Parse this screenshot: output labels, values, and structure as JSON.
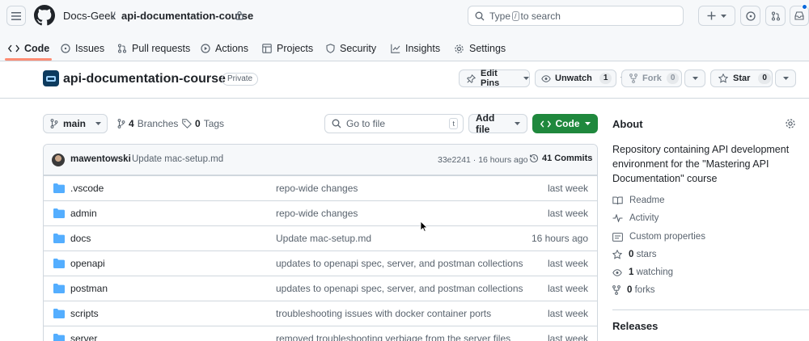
{
  "header": {
    "owner": "Docs-Geek",
    "separator": "/",
    "repo": "api-documentation-course",
    "search_prefix": "Type",
    "search_key": "/",
    "search_suffix": "to search"
  },
  "tabs": [
    {
      "label": "Code",
      "icon": "code-icon",
      "active": true
    },
    {
      "label": "Issues",
      "icon": "issue-icon"
    },
    {
      "label": "Pull requests",
      "icon": "pull-request-icon"
    },
    {
      "label": "Actions",
      "icon": "play-icon"
    },
    {
      "label": "Projects",
      "icon": "table-icon"
    },
    {
      "label": "Security",
      "icon": "shield-icon"
    },
    {
      "label": "Insights",
      "icon": "graph-icon"
    },
    {
      "label": "Settings",
      "icon": "gear-icon"
    }
  ],
  "repo": {
    "name": "api-documentation-course",
    "visibility": "Private",
    "edit_pins": "Edit Pins",
    "unwatch": "Unwatch",
    "watch_count": "1",
    "fork": "Fork",
    "fork_count": "0",
    "star": "Star",
    "star_count": "0"
  },
  "toolbar": {
    "branch": "main",
    "branches_count": "4",
    "branches_label": "Branches",
    "tags_count": "0",
    "tags_label": "Tags",
    "goto_placeholder": "Go to file",
    "goto_key": "t",
    "add_file": "Add file",
    "code": "Code"
  },
  "commit": {
    "author": "mawentowski",
    "message": "Update mac-setup.md",
    "meta": "33e2241 · 16 hours ago",
    "commits_label": "41 Commits"
  },
  "files": [
    {
      "name": ".vscode",
      "message": "repo-wide changes",
      "date": "last week"
    },
    {
      "name": "admin",
      "message": "repo-wide changes",
      "date": "last week"
    },
    {
      "name": "docs",
      "message": "Update mac-setup.md",
      "date": "16 hours ago"
    },
    {
      "name": "openapi",
      "message": "updates to openapi spec, server, and postman collections",
      "date": "last week"
    },
    {
      "name": "postman",
      "message": "updates to openapi spec, server, and postman collections",
      "date": "last week"
    },
    {
      "name": "scripts",
      "message": "troubleshooting issues with docker container ports",
      "date": "last week"
    },
    {
      "name": "server",
      "message": "removed troubleshooting verbiage from the server files",
      "date": "last week"
    }
  ],
  "about": {
    "heading": "About",
    "description": "Repository containing API development environment for the \"Mastering API Documentation\" course",
    "readme": "Readme",
    "activity": "Activity",
    "custom_properties": "Custom properties",
    "stars_count": "0",
    "stars_label": "stars",
    "watching_count": "1",
    "watching_label": "watching",
    "forks_count": "0",
    "forks_label": "forks",
    "releases": "Releases"
  },
  "colors": {
    "accent_green": "#1f883d",
    "folder_blue": "#54aeff",
    "tab_underline": "#fd8c73",
    "border": "#d0d7de"
  }
}
